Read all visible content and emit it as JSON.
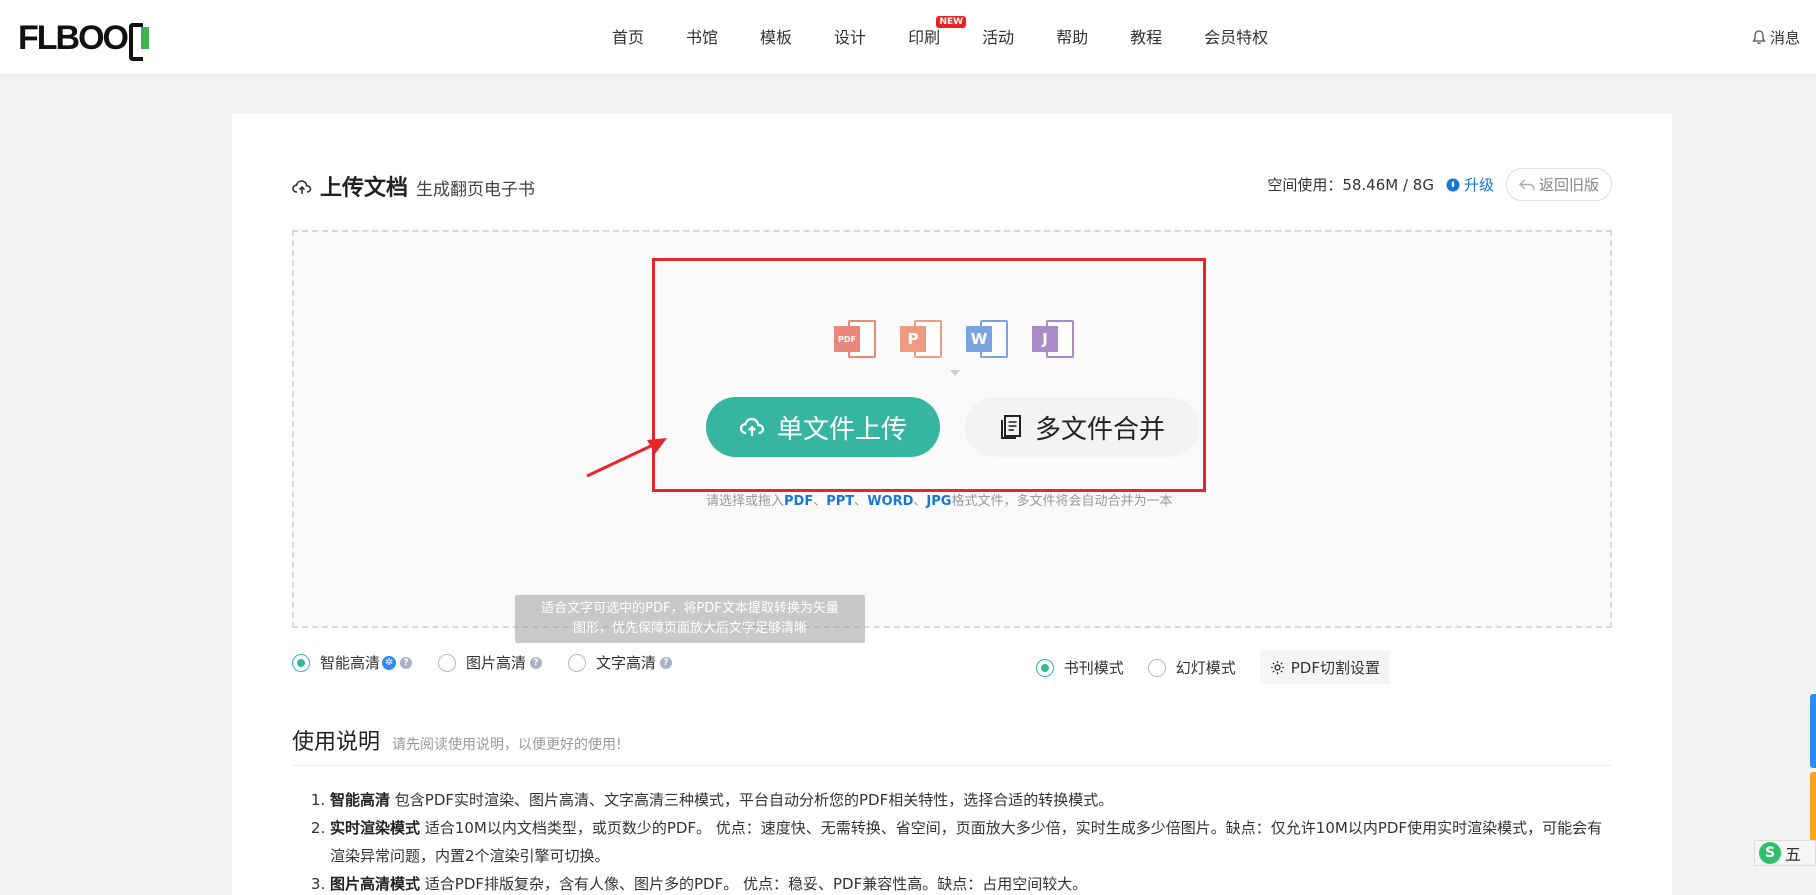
{
  "header": {
    "logo_text": "FLBOO",
    "nav": [
      "首页",
      "书馆",
      "模板",
      "设计",
      "印刷",
      "活动",
      "帮助",
      "教程",
      "会员特权"
    ],
    "new_badge": "NEW",
    "message": "消息"
  },
  "upload": {
    "title": "上传文档",
    "subtitle": "生成翻页电子书",
    "space_label": "空间使用：58.46M / 8G",
    "upgrade": "升级",
    "old_version": "返回旧版",
    "file_icons": [
      {
        "name": "pdf-file-icon",
        "letter": "PDF",
        "color": "#e8877a"
      },
      {
        "name": "ppt-file-icon",
        "letter": "P",
        "color": "#ee9b82"
      },
      {
        "name": "word-file-icon",
        "letter": "W",
        "color": "#7aa3e0"
      },
      {
        "name": "jpg-file-icon",
        "letter": "J",
        "color": "#a98cc6"
      }
    ],
    "single_button": "单文件上传",
    "multi_button": "多文件合并",
    "hint_prefix": "请选择或拖入",
    "hint_pdf": "PDF",
    "hint_sep1": "、",
    "hint_ppt": "PPT",
    "hint_sep2": "、",
    "hint_word": "WORD",
    "hint_sep3": "、",
    "hint_jpg": "JPG",
    "hint_suffix": "格式文件，多文件将会自动合并为一本"
  },
  "tooltip": {
    "line1": "适合文字可选中的PDF，将PDF文本提取转换为矢量",
    "line2": "图形，优先保障页面放大后文字足够清晰"
  },
  "modes": {
    "smart": "智能高清",
    "image": "图片高清",
    "text": "文字高清",
    "book": "书刊模式",
    "slide": "幻灯模式",
    "pdf_cut": "PDF切割设置"
  },
  "guide": {
    "title": "使用说明",
    "subtitle": "请先阅读使用说明，以便更好的使用!",
    "items": [
      {
        "bold": "智能高清",
        "text": " 包含PDF实时渲染、图片高清、文字高清三种模式，平台自动分析您的PDF相关特性，选择合适的转换模式。"
      },
      {
        "bold": "实时渲染模式",
        "text": " 适合10M以内文档类型，或页数少的PDF。 优点：速度快、无需转换、省空间，页面放大多少倍，实时生成多少倍图片。缺点：仅允许10M以内PDF使用实时渲染模式，可能会有渲染异常问题，内置2个渲染引擎可切换。"
      },
      {
        "bold": "图片高清模式",
        "text": " 适合PDF排版复杂，含有人像、图片多的PDF。 优点：稳妥、PDF兼容性高。缺点：占用空间较大。"
      }
    ]
  },
  "ime": {
    "label": "五"
  }
}
